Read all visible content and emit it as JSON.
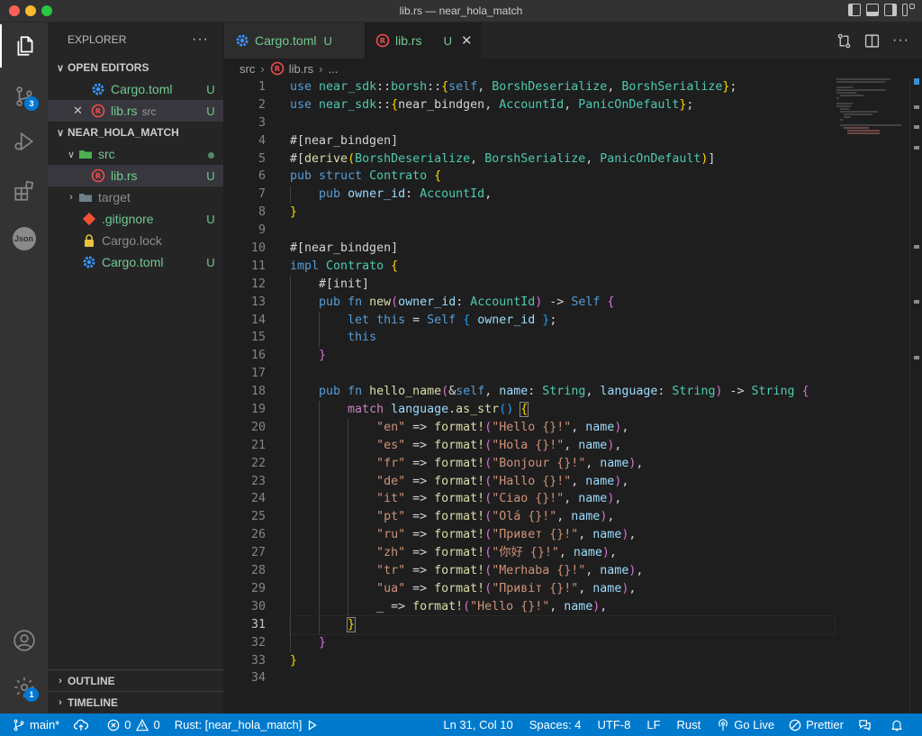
{
  "window": {
    "title": "lib.rs — near_hola_match"
  },
  "activity": {
    "scm_badge": "3",
    "manage_badge": "1",
    "json_label": "Json"
  },
  "explorer": {
    "title": "EXPLORER",
    "open_editors_label": "OPEN EDITORS",
    "open_editors": [
      {
        "name": "Cargo.toml",
        "status": "U"
      },
      {
        "name": "lib.rs",
        "sub": "src",
        "status": "U"
      }
    ],
    "project_label": "NEAR_HOLA_MATCH",
    "tree": {
      "src": "src",
      "lib": {
        "name": "lib.rs",
        "status": "U"
      },
      "target": "target",
      "gitignore": {
        "name": ".gitignore",
        "status": "U"
      },
      "cargolock": "Cargo.lock",
      "cargotoml": {
        "name": "Cargo.toml",
        "status": "U"
      }
    },
    "outline_label": "OUTLINE",
    "timeline_label": "TIMELINE"
  },
  "tabs": [
    {
      "name": "Cargo.toml",
      "status": "U"
    },
    {
      "name": "lib.rs",
      "status": "U"
    }
  ],
  "breadcrumb": {
    "folder": "src",
    "file": "lib.rs",
    "more": "..."
  },
  "editor": {
    "line_numbers": [
      "1",
      "2",
      "3",
      "4",
      "5",
      "6",
      "7",
      "8",
      "9",
      "10",
      "11",
      "12",
      "13",
      "14",
      "15",
      "16",
      "17",
      "18",
      "19",
      "20",
      "21",
      "22",
      "23",
      "24",
      "25",
      "26",
      "27",
      "28",
      "29",
      "30",
      "31",
      "32",
      "33",
      "34"
    ],
    "strings": {
      "en": "\"en\"",
      "es": "\"es\"",
      "fr": "\"fr\"",
      "de": "\"de\"",
      "it": "\"it\"",
      "pt": "\"pt\"",
      "ru": "\"ru\"",
      "zh": "\"zh\"",
      "tr": "\"tr\"",
      "ua": "\"ua\"",
      "hello": "\"Hello {}!\"",
      "hola": "\"Hola {}!\"",
      "bonjour": "\"Bonjour {}!\"",
      "hallo": "\"Hallo {}!\"",
      "ciao": "\"Ciao {}!\"",
      "ola": "\"Olá {}!\"",
      "privet": "\"Привет {}!\"",
      "nihao": "\"你好 {}!\"",
      "merhaba": "\"Merhaba {}!\"",
      "pryvit": "\"Привіт {}!\"",
      "default_hello": "\"Hello {}!\""
    }
  },
  "statusbar": {
    "branch": "main*",
    "errors": "0",
    "warnings": "0",
    "rust": "Rust: [near_hola_match]",
    "position": "Ln 31, Col 10",
    "spaces": "Spaces: 4",
    "encoding": "UTF-8",
    "eol": "LF",
    "language": "Rust",
    "golive": "Go Live",
    "prettier": "Prettier"
  }
}
